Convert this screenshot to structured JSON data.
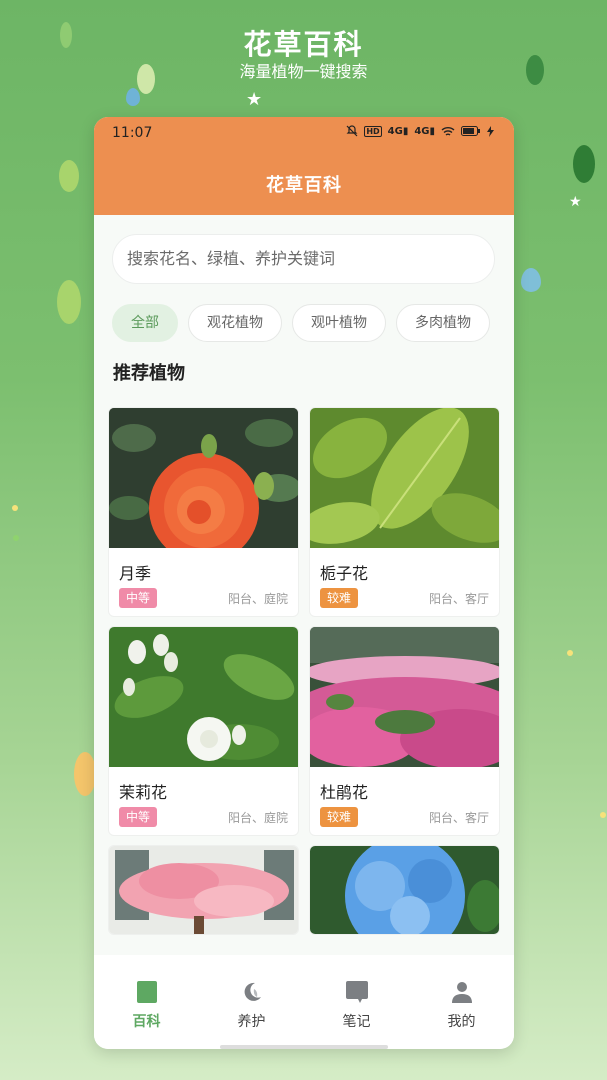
{
  "promo": {
    "title": "花草百科",
    "subtitle": "海量植物一键搜索"
  },
  "status": {
    "time": "11:07",
    "icons": [
      "mute-icon",
      "hd-icon",
      "4g-signal-icon",
      "4g-signal-icon",
      "wifi-icon",
      "battery-icon",
      "charging-icon"
    ]
  },
  "app": {
    "title": "花草百科"
  },
  "search": {
    "placeholder": "搜索花名、绿植、养护关键词"
  },
  "chips": [
    {
      "label": "全部",
      "active": true
    },
    {
      "label": "观花植物",
      "active": false
    },
    {
      "label": "观叶植物",
      "active": false
    },
    {
      "label": "多肉植物",
      "active": false
    }
  ],
  "section": {
    "title": "推荐植物"
  },
  "plants": [
    {
      "name": "月季",
      "difficulty": "中等",
      "difficulty_color": "#f08ba8",
      "place": "阳台、庭院"
    },
    {
      "name": "栀子花",
      "difficulty": "较难",
      "difficulty_color": "#ed9340",
      "place": "阳台、客厅"
    },
    {
      "name": "茉莉花",
      "difficulty": "中等",
      "difficulty_color": "#f08ba8",
      "place": "阳台、庭院"
    },
    {
      "name": "杜鹃花",
      "difficulty": "较难",
      "difficulty_color": "#ed9340",
      "place": "阳台、客厅"
    },
    {
      "name": "",
      "difficulty": "",
      "difficulty_color": "",
      "place": ""
    },
    {
      "name": "",
      "difficulty": "",
      "difficulty_color": "",
      "place": ""
    }
  ],
  "tabs": [
    {
      "label": "百科",
      "icon": "book-icon",
      "active": true
    },
    {
      "label": "养护",
      "icon": "moon-leaf-icon",
      "active": false
    },
    {
      "label": "笔记",
      "icon": "note-icon",
      "active": false
    },
    {
      "label": "我的",
      "icon": "user-icon",
      "active": false
    }
  ],
  "colors": {
    "accent_orange": "#ed8f50",
    "accent_green": "#5ea862",
    "background_green": "#7cbf6f"
  }
}
